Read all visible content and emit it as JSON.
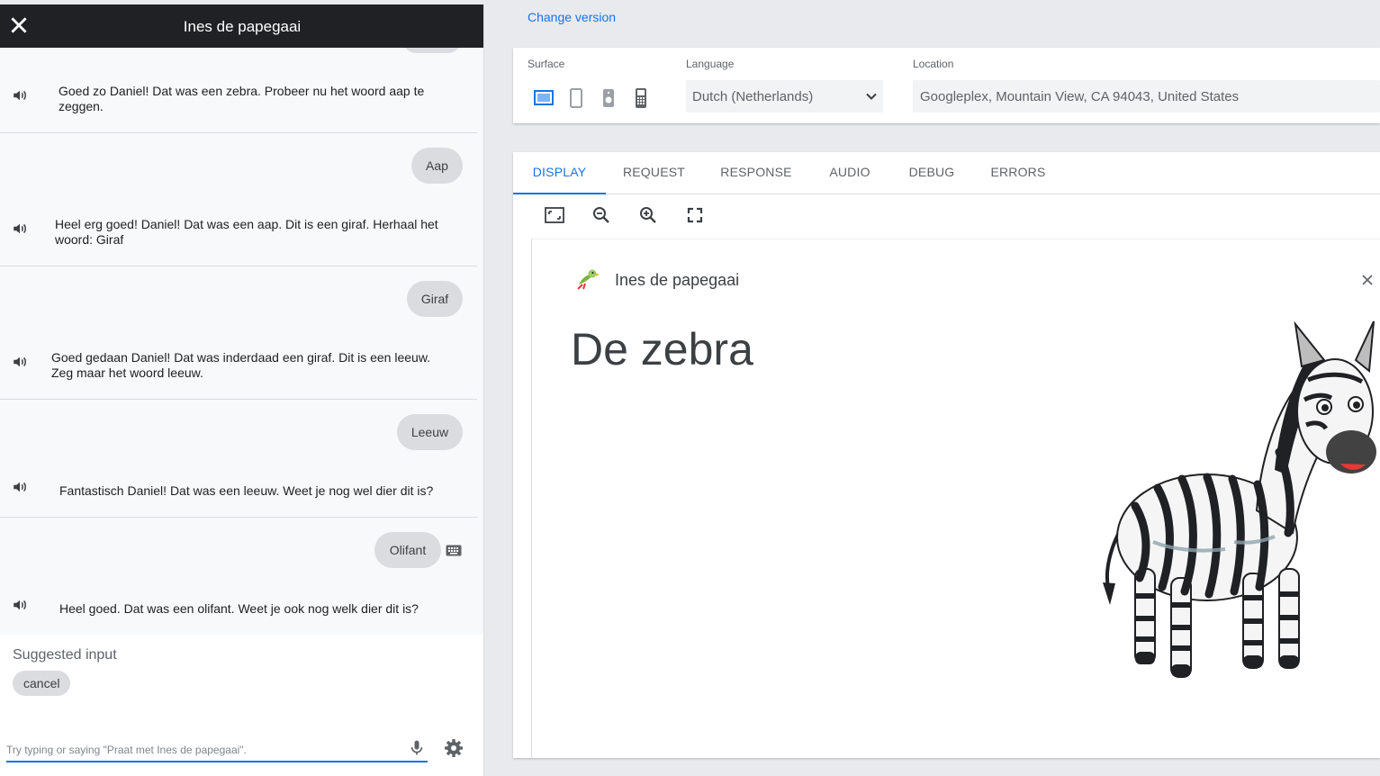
{
  "chat": {
    "title": "Ines de papegaai",
    "messages": [
      {
        "role": "agent",
        "text": "Goed zo Daniel! Dat was een zebra. Probeer nu het woord aap te zeggen."
      },
      {
        "role": "user",
        "text": "Aap"
      },
      {
        "role": "agent",
        "text": "Heel erg goed! Daniel! Dat was een aap. Dit is een giraf. Herhaal het woord: Giraf"
      },
      {
        "role": "user",
        "text": "Giraf"
      },
      {
        "role": "agent",
        "text": "Goed gedaan Daniel! Dat was inderdaad een giraf. Dit is een leeuw. Zeg maar het woord leeuw."
      },
      {
        "role": "user",
        "text": "Leeuw"
      },
      {
        "role": "agent",
        "text": "Fantastisch Daniel! Dat was een leeuw. Weet je nog wel dier dit is?"
      },
      {
        "role": "user",
        "text": "Olifant"
      },
      {
        "role": "agent",
        "text": "Heel goed. Dat was een olifant. Weet je ook nog welk dier dit is?"
      }
    ],
    "suggested_label": "Suggested input",
    "suggestions": [
      "cancel"
    ],
    "input_placeholder": "Try typing or saying \"Praat met Ines de papegaai\"."
  },
  "change_version": "Change version",
  "settings": {
    "surface_label": "Surface",
    "surfaces": [
      "smart-display-icon",
      "phone-icon",
      "speaker-icon",
      "kaios-phone-icon"
    ],
    "selected_surface": "smart-display-icon",
    "language_label": "Language",
    "language_value": "Dutch (Netherlands)",
    "location_label": "Location",
    "location_value": "Googleplex, Mountain View, CA 94043, United States"
  },
  "tabs": [
    "DISPLAY",
    "REQUEST",
    "RESPONSE",
    "AUDIO",
    "DEBUG",
    "ERRORS"
  ],
  "active_tab": "DISPLAY",
  "display": {
    "bot_name": "Ines de papegaai",
    "card_title": "De zebra"
  },
  "colors": {
    "accent": "#1a73e8",
    "header_bg": "#202124",
    "bubble_bg": "#dadce0"
  }
}
